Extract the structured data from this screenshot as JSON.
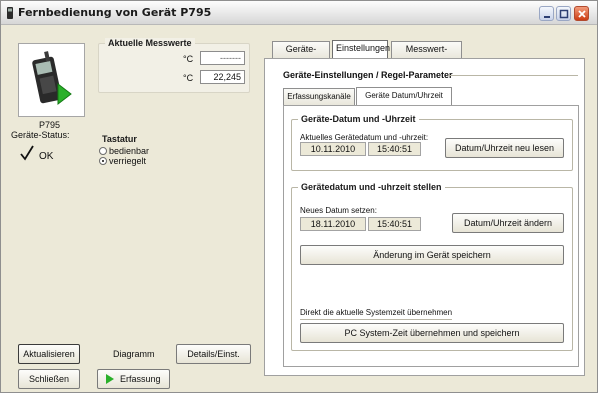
{
  "window": {
    "title": "Fernbedienung von Gerät P795",
    "minimize_icon": "minimize-icon",
    "maximize_icon": "maximize-icon",
    "close_icon": "close-icon"
  },
  "device": {
    "name": "P795",
    "status_label": "Geräte-Status:",
    "status_value": "OK",
    "status_icon": "checkmark-icon"
  },
  "measurements": {
    "title": "Aktuelle Messwerte",
    "rows": [
      {
        "unit": "°C",
        "value": "-------"
      },
      {
        "unit": "°C",
        "value": "22,245"
      }
    ]
  },
  "keyboard": {
    "title": "Tastatur",
    "options": [
      {
        "label": "bedienbar",
        "selected": false
      },
      {
        "label": "verriegelt",
        "selected": true
      }
    ]
  },
  "left_buttons": {
    "refresh": "Aktualisieren",
    "chart": "Diagramm",
    "details": "Details/Einst.",
    "close": "Schließen",
    "record": "Erfassung"
  },
  "main_tabs": [
    "Geräte-Status",
    "Einstellungen",
    "Messwert-Speicher"
  ],
  "main_tab_active": "Einstellungen",
  "settings": {
    "title": "Geräte-Einstellungen / Regel-Parameter",
    "sub_tabs": [
      "Erfassungskanäle",
      "Geräte Datum/Uhrzeit"
    ],
    "sub_tab_active": "Geräte Datum/Uhrzeit",
    "current": {
      "title": "Geräte-Datum und -Uhrzeit",
      "label": "Aktuelles Gerätedatum und -uhrzeit:",
      "date": "10.11.2010",
      "time": "15:40:51",
      "reload_button": "Datum/Uhrzeit neu lesen"
    },
    "set": {
      "title": "Gerätedatum und -uhrzeit stellen",
      "label": "Neues Datum setzen:",
      "date": "18.11.2010",
      "time": "15:40:51",
      "change_button": "Datum/Uhrzeit ändern",
      "save_button": "Änderung im Gerät speichern",
      "system_label": "Direkt die aktuelle Systemzeit übernehmen",
      "system_button": "PC System-Zeit übernehmen und speichern"
    }
  }
}
